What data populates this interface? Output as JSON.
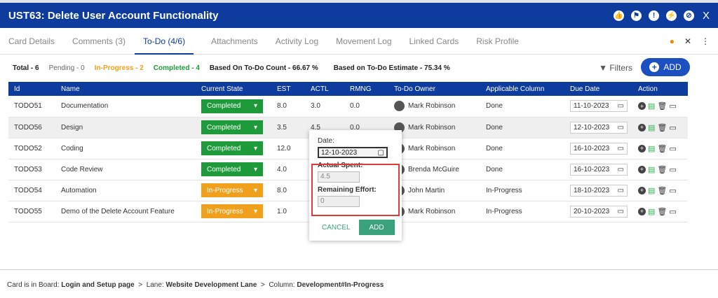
{
  "header": {
    "title": "UST63:  Delete User Account Functionality",
    "close": "X"
  },
  "tabs": [
    "Card Details",
    "Comments (3)",
    "To-Do (4/6)",
    "Attachments",
    "Activity Log",
    "Movement Log",
    "Linked Cards",
    "Risk Profile"
  ],
  "stats": {
    "total": "Total - 6",
    "pending": "Pending - 0",
    "in_progress": "In-Progress - 2",
    "completed": "Completed - 4",
    "count": "Based On To-Do Count - 66.67 %",
    "estimate": "Based on To-Do Estimate - 75.34 %"
  },
  "toolbar": {
    "filters": "Filters",
    "add": "ADD"
  },
  "table": {
    "headers": [
      "Id",
      "Name",
      "Current State",
      "EST",
      "ACTL",
      "RMNG",
      "To-Do Owner",
      "Applicable Column",
      "Due Date",
      "Action"
    ],
    "rows": [
      {
        "id": "TODO51",
        "name": "Documentation",
        "state": "Completed",
        "est": "8.0",
        "actl": "3.0",
        "rmng": "0.0",
        "owner": "Mark Robinson",
        "column": "Done",
        "due": "11-10-2023"
      },
      {
        "id": "TODO56",
        "name": "Design",
        "state": "Completed",
        "est": "3.5",
        "actl": "4.5",
        "rmng": "0.0",
        "owner": "Mark Robinson",
        "column": "Done",
        "due": "12-10-2023"
      },
      {
        "id": "TODO52",
        "name": "Coding",
        "state": "Completed",
        "est": "12.0",
        "actl": "",
        "rmng": "",
        "owner": "Mark Robinson",
        "column": "Done",
        "due": "16-10-2023"
      },
      {
        "id": "TODO53",
        "name": "Code Review",
        "state": "Completed",
        "est": "4.0",
        "actl": "",
        "rmng": "",
        "owner": "Brenda McGuire",
        "column": "Done",
        "due": "16-10-2023"
      },
      {
        "id": "TODO54",
        "name": "Automation",
        "state": "In-Progress",
        "est": "8.0",
        "actl": "",
        "rmng": "",
        "owner": "John Martin",
        "column": "In-Progress",
        "due": "18-10-2023"
      },
      {
        "id": "TODO55",
        "name": "Demo of the Delete Account Feature",
        "state": "In-Progress",
        "est": "1.0",
        "actl": "",
        "rmng": "",
        "owner": "Mark Robinson",
        "column": "In-Progress",
        "due": "20-10-2023"
      }
    ]
  },
  "popup": {
    "date_label": "Date:",
    "date": "12-10-2023",
    "actual_label": "Actual Spent:",
    "actual": "4.5",
    "remaining_label": "Remaining Effort:",
    "remaining": "0",
    "cancel": "CANCEL",
    "add": "ADD"
  },
  "footer": {
    "board_label": "Card is in Board:",
    "board": "Login and Setup page",
    "lane_label": "Lane:",
    "lane": "Website Development Lane",
    "column_label": "Column:",
    "column": "Development#In-Progress",
    "sep": ">"
  }
}
